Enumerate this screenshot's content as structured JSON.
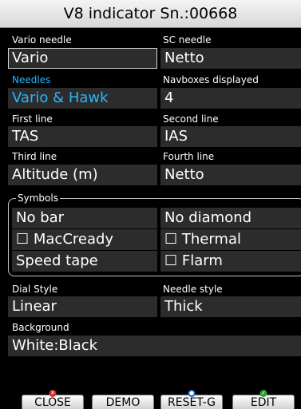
{
  "title": "V8 indicator Sn.:00668",
  "fields": {
    "vario_needle": {
      "label": "Vario needle",
      "value": "Vario"
    },
    "sc_needle": {
      "label": "SC needle",
      "value": "Netto"
    },
    "needles": {
      "label": "Needles",
      "value": "Vario & Hawk"
    },
    "navboxes": {
      "label": "Navboxes displayed",
      "value": "4"
    },
    "first_line": {
      "label": "First line",
      "value": "TAS"
    },
    "second_line": {
      "label": "Second line",
      "value": "IAS"
    },
    "third_line": {
      "label": "Third line",
      "value": "Altitude (m)"
    },
    "fourth_line": {
      "label": "Fourth line",
      "value": "Netto"
    },
    "dial_style": {
      "label": "Dial Style",
      "value": "Linear"
    },
    "needle_style": {
      "label": "Needle style",
      "value": "Thick"
    },
    "background": {
      "label": "Background",
      "value": "White:Black"
    }
  },
  "symbols": {
    "title": "Symbols",
    "bar": "No bar",
    "diamond": "No diamond",
    "maccready": {
      "label": "MacCready",
      "checked": false
    },
    "thermal": {
      "label": "Thermal",
      "checked": false
    },
    "speed_tape": "Speed tape",
    "flarm": {
      "label": "Flarm",
      "checked": false
    },
    "checkbox_glyph": "☐"
  },
  "buttons": {
    "close": "CLOSE",
    "demo": "DEMO",
    "reset": "RESET-G",
    "edit": "EDIT"
  },
  "colors": {
    "accent": "#29b6ff",
    "field_bg": "#2c2c2c",
    "close_badge": "#d32f2f",
    "reset_badge": "#1e63c9",
    "edit_badge": "#2e9d3a"
  }
}
